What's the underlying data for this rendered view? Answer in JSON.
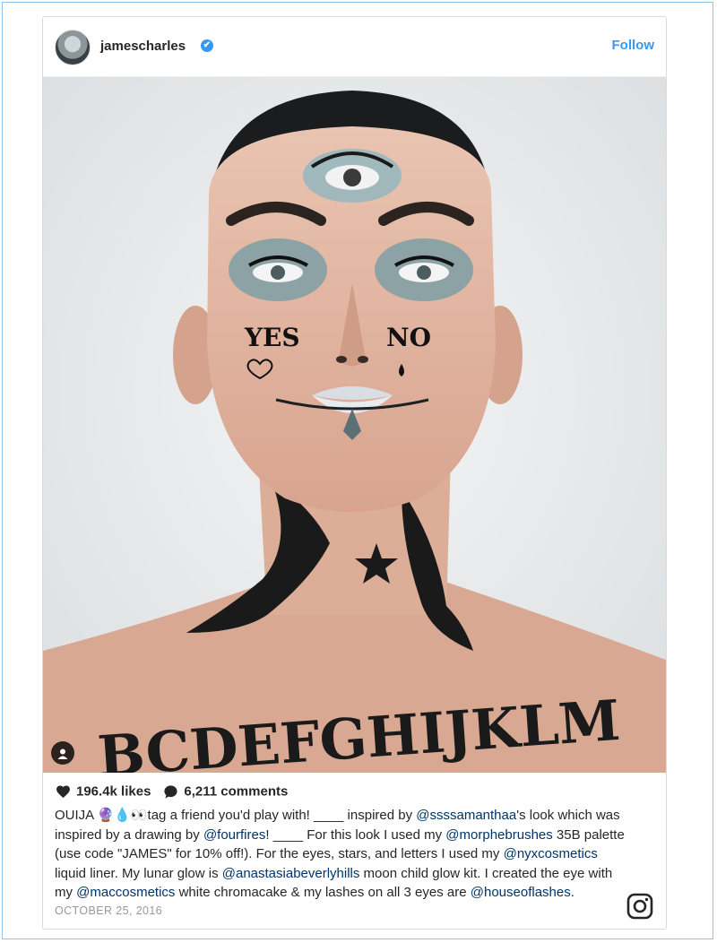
{
  "post": {
    "username": "jamescharles",
    "verified_badge": "✔",
    "follow_label": "Follow",
    "likes": "196.4k likes",
    "comments": "6,211 comments",
    "caption": {
      "p1": "OUIJA ",
      "emoji": "🔮💧👀",
      "p2": "tag a friend you'd play with! ____ inspired by ",
      "m1": "@ssssamanthaa",
      "p3": "'s look which was inspired by a drawing by ",
      "m2": "@fourfires",
      "p4": "! ____ For this look I used my ",
      "m3": "@morphebrushes",
      "p5": " 35B palette (use code \"JAMES\" for 10% off!). For the eyes, stars, and letters I used my ",
      "m4": "@nyxcosmetics",
      "p6": " liquid liner. My lunar glow is ",
      "m5": "@anastasiabeverlyhills",
      "p7": " moon child glow kit. I created the eye with my ",
      "m6": "@maccosmetics",
      "p8": " white chromacake & my lashes on all 3 eyes are ",
      "m7": "@houseoflashes",
      "p9": "."
    },
    "date": "OCTOBER 25, 2016"
  },
  "photo": {
    "cheek_left_text": "YES",
    "cheek_right_text": "NO",
    "chest_letters": "BCDEFGHIJKLM"
  },
  "colors": {
    "accent": "#3897f0",
    "mention": "#003569",
    "text": "#262626",
    "muted": "#999999"
  },
  "icons": [
    "heart-icon",
    "comment-icon",
    "instagram-logo-icon",
    "user-tag-icon",
    "verified-icon"
  ]
}
